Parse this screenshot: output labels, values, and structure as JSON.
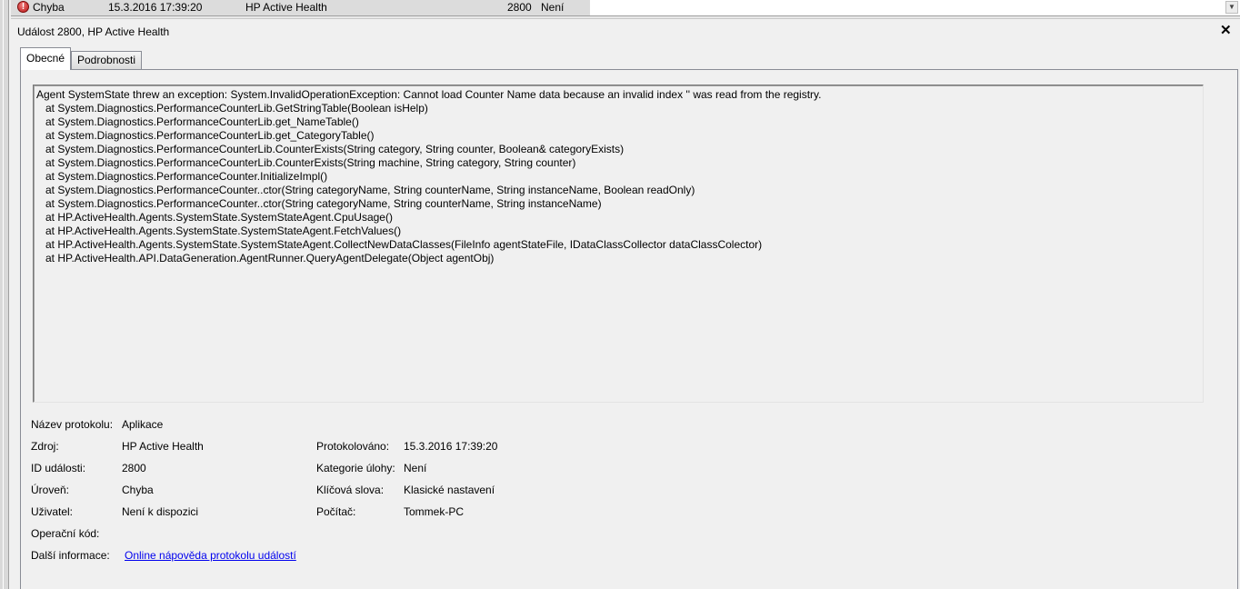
{
  "top_row": {
    "level": "Chyba",
    "datetime": "15.3.2016 17:39:20",
    "source": "HP Active Health",
    "event_id": "2800",
    "category": "Není"
  },
  "pane": {
    "title": "Událost 2800, HP Active Health",
    "close_glyph": "✕"
  },
  "tabs": [
    {
      "label": "Obecné",
      "active": true
    },
    {
      "label": "Podrobnosti",
      "active": false
    }
  ],
  "message_lines": [
    "Agent SystemState threw an exception: System.InvalidOperationException: Cannot load Counter Name data because an invalid index '' was read from the registry.",
    "   at System.Diagnostics.PerformanceCounterLib.GetStringTable(Boolean isHelp)",
    "   at System.Diagnostics.PerformanceCounterLib.get_NameTable()",
    "   at System.Diagnostics.PerformanceCounterLib.get_CategoryTable()",
    "   at System.Diagnostics.PerformanceCounterLib.CounterExists(String category, String counter, Boolean& categoryExists)",
    "   at System.Diagnostics.PerformanceCounterLib.CounterExists(String machine, String category, String counter)",
    "   at System.Diagnostics.PerformanceCounter.InitializeImpl()",
    "   at System.Diagnostics.PerformanceCounter..ctor(String categoryName, String counterName, String instanceName, Boolean readOnly)",
    "   at System.Diagnostics.PerformanceCounter..ctor(String categoryName, String counterName, String instanceName)",
    "   at HP.ActiveHealth.Agents.SystemState.SystemStateAgent.CpuUsage()",
    "   at HP.ActiveHealth.Agents.SystemState.SystemStateAgent.FetchValues()",
    "   at HP.ActiveHealth.Agents.SystemState.SystemStateAgent.CollectNewDataClasses(FileInfo agentStateFile, IDataClassCollector dataClassColector)",
    "   at HP.ActiveHealth.API.DataGeneration.AgentRunner.QueryAgentDelegate(Object agentObj)"
  ],
  "details": {
    "log_name_label": "Název protokolu:",
    "log_name": "Aplikace",
    "source_label": "Zdroj:",
    "source": "HP Active Health",
    "logged_label": "Protokolováno:",
    "logged": "15.3.2016 17:39:20",
    "event_id_label": "ID události:",
    "event_id": "2800",
    "task_category_label": "Kategorie úlohy:",
    "task_category": "Není",
    "level_label": "Úroveň:",
    "level": "Chyba",
    "keywords_label": "Klíčová slova:",
    "keywords": "Klasické nastavení",
    "user_label": "Uživatel:",
    "user": "Není k dispozici",
    "computer_label": "Počítač:",
    "computer": "Tommek-PC",
    "opcode_label": "Operační kód:",
    "more_info_label": "Další informace:",
    "more_info_link": "Online nápověda protokolu událostí"
  }
}
